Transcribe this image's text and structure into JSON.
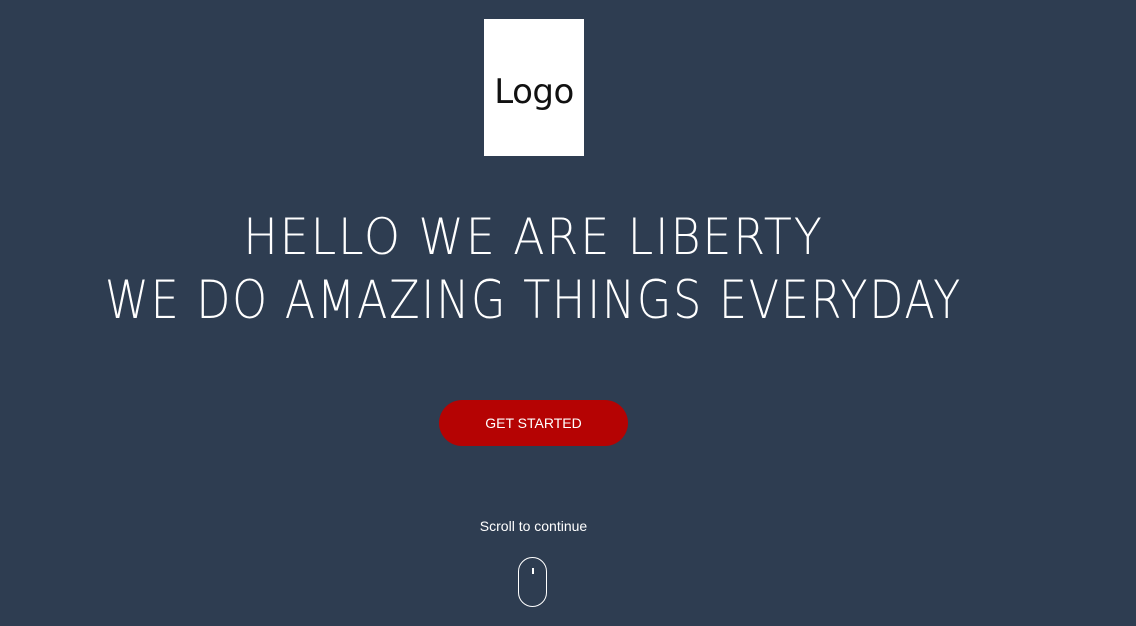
{
  "logo": {
    "text": "Logo"
  },
  "hero": {
    "line1": "HELLO WE ARE LIBERTY",
    "line2": "WE DO AMAZING THINGS EVERYDAY"
  },
  "cta": {
    "label": "GET STARTED",
    "color": "#b50303"
  },
  "scroll": {
    "text": "Scroll to continue",
    "icon": "mouse-icon"
  },
  "colors": {
    "background": "#2e3d51",
    "text": "#ffffff"
  }
}
